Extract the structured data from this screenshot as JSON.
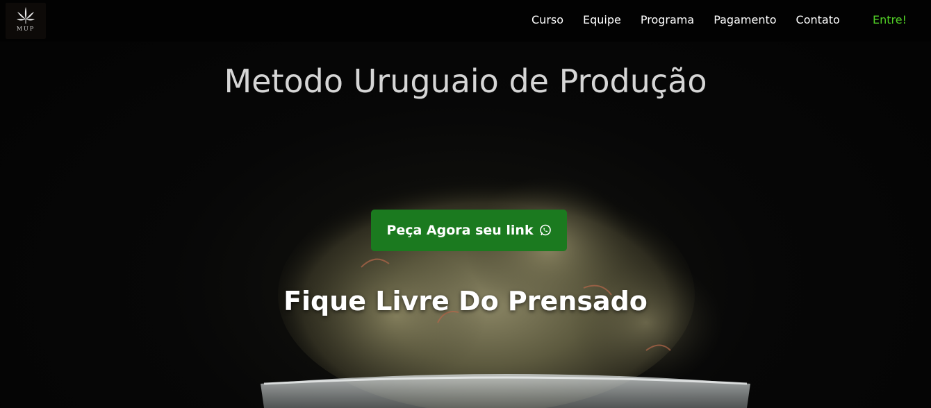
{
  "brand": {
    "logo_text": "MUP",
    "logo_icon": "cannabis-leaf-icon"
  },
  "nav": {
    "items": [
      {
        "label": "Curso"
      },
      {
        "label": "Equipe"
      },
      {
        "label": "Programa"
      },
      {
        "label": "Pagamento"
      },
      {
        "label": "Contato"
      }
    ],
    "cta_label": "Entre!",
    "cta_color": "#52d126"
  },
  "hero": {
    "title": "Metodo Uruguaio de Produção",
    "button_label": "Peça Agora seu link",
    "button_icon": "whatsapp-icon",
    "button_color": "#1b7a1f",
    "subtitle": "Fique Livre Do Prensado"
  }
}
